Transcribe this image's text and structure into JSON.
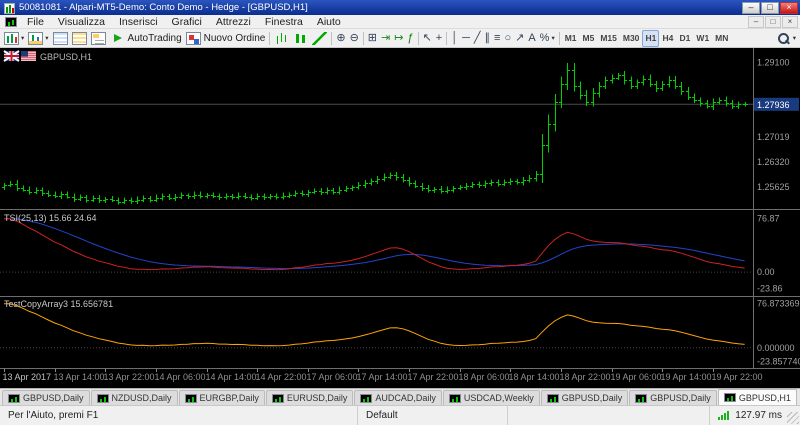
{
  "window": {
    "title": "50081081 - Alpari-MT5-Demo: Conto Demo - Hedge - [GBPUSD,H1]",
    "controls": [
      {
        "name": "minimize-button",
        "glyph": "–"
      },
      {
        "name": "maximize-button",
        "glyph": "□"
      },
      {
        "name": "close-button",
        "glyph": "×"
      }
    ]
  },
  "menu": {
    "items": [
      "File",
      "Visualizza",
      "Inserisci",
      "Grafici",
      "Attrezzi",
      "Finestra",
      "Aiuto"
    ],
    "child_controls": [
      {
        "name": "chart-minimize-button",
        "glyph": "–"
      },
      {
        "name": "chart-restore-button",
        "glyph": "□"
      },
      {
        "name": "chart-close-button",
        "glyph": "×"
      }
    ]
  },
  "toolbar": {
    "items": [
      {
        "name": "new-chart-button",
        "icon": "candles-icon",
        "caret": true
      },
      {
        "name": "profiles-button",
        "icon": "profiles-icon",
        "caret": true
      },
      {
        "name": "market-watch-button",
        "icon": "market-watch-icon"
      },
      {
        "name": "data-window-button",
        "icon": "data-window-icon"
      },
      {
        "name": "navigator-button",
        "icon": "navigator-icon"
      },
      {
        "name": "autotrading-button",
        "icon": "play-icon",
        "label": "AutoTrading"
      },
      {
        "name": "new-order-button",
        "icon": "new-order-icon",
        "label": "Nuovo Ordine"
      },
      {
        "sep": true
      },
      {
        "name": "bar-chart-button",
        "icon": "bar-chart-icon"
      },
      {
        "name": "candle-chart-button",
        "icon": "candle-chart-icon"
      },
      {
        "name": "line-chart-button",
        "icon": "line-chart-icon"
      },
      {
        "sep": true
      },
      {
        "name": "zoom-in-button",
        "glyph": "⊕"
      },
      {
        "name": "zoom-out-button",
        "glyph": "⊖"
      },
      {
        "sep": true
      },
      {
        "name": "tile-windows-button",
        "glyph": "⊞"
      },
      {
        "name": "auto-scroll-button",
        "glyph": "⇥",
        "color": "#1f8b1f"
      },
      {
        "name": "chart-shift-button",
        "glyph": "↦",
        "color": "#1f8b1f"
      },
      {
        "name": "indicators-button",
        "glyph": "ƒ",
        "color": "#0a7d0a"
      },
      {
        "sep": true
      },
      {
        "name": "cursor-button",
        "glyph": "↖"
      },
      {
        "name": "crosshair-button",
        "glyph": "+"
      },
      {
        "sep": true
      },
      {
        "name": "vertical-line-button",
        "glyph": "│"
      },
      {
        "name": "horizontal-line-button",
        "glyph": "─"
      },
      {
        "name": "trendline-button",
        "glyph": "╱"
      },
      {
        "name": "channel-button",
        "glyph": "∥"
      },
      {
        "name": "fibonacci-button",
        "glyph": "≡"
      },
      {
        "name": "shapes-button",
        "glyph": "○"
      },
      {
        "name": "arrows-button",
        "glyph": "↗"
      },
      {
        "name": "text-button",
        "glyph": "A"
      },
      {
        "name": "objects-button",
        "glyph": "%",
        "caret": true
      },
      {
        "sep": true
      }
    ],
    "timeframes": [
      "M1",
      "M5",
      "M15",
      "M30",
      "H1",
      "H4",
      "D1",
      "W1",
      "MN"
    ],
    "active_timeframe": "H1"
  },
  "chart": {
    "symbol_label": "GBPUSD,H1",
    "flags": [
      "gb-flag-icon",
      "us-flag-icon"
    ]
  },
  "tabs": {
    "items": [
      "GBPUSD,Daily",
      "NZDUSD,Daily",
      "EURGBP,Daily",
      "EURUSD,Daily",
      "AUDCAD,Daily",
      "USDCAD,Weekly",
      "GBPUSD,Daily",
      "GBPUSD,Daily",
      "GBPUSD,H1"
    ],
    "active_index": 8
  },
  "status_bar": {
    "help": "Per l'Aiuto, premi F1",
    "profile": "Default",
    "ping": "127.97 ms"
  },
  "chart_data": {
    "type": "ohlc-bars",
    "symbol": "GBPUSD",
    "timeframe": "H1",
    "bar_color": "#00D000",
    "background": "#000000",
    "main": {
      "open_first": 1.2563,
      "closes": [
        1.2568,
        1.2572,
        1.2561,
        1.2556,
        1.255,
        1.2554,
        1.2546,
        1.2542,
        1.2538,
        1.2543,
        1.2536,
        1.253,
        1.2534,
        1.2528,
        1.2532,
        1.2526,
        1.253,
        1.2526,
        1.2522,
        1.2527,
        1.2523,
        1.2528,
        1.2532,
        1.2528,
        1.2533,
        1.2537,
        1.2532,
        1.2536,
        1.254,
        1.2537,
        1.2542,
        1.2538,
        1.2541,
        1.2537,
        1.2534,
        1.2538,
        1.2535,
        1.2539,
        1.2536,
        1.2533,
        1.2537,
        1.2534,
        1.2538,
        1.2535,
        1.2539,
        1.2542,
        1.2546,
        1.2543,
        1.2548,
        1.2552,
        1.2549,
        1.2554,
        1.255,
        1.2556,
        1.2559,
        1.2562,
        1.2568,
        1.2574,
        1.258,
        1.2586,
        1.2592,
        1.2597,
        1.259,
        1.2582,
        1.2574,
        1.2566,
        1.256,
        1.2554,
        1.2558,
        1.2552,
        1.2556,
        1.256,
        1.2562,
        1.2566,
        1.2571,
        1.2568,
        1.2573,
        1.2577,
        1.2572,
        1.2576,
        1.258,
        1.2576,
        1.2582,
        1.2588,
        1.26,
        1.268,
        1.274,
        1.28,
        1.285,
        1.289,
        1.2845,
        1.282,
        1.28,
        1.2825,
        1.2845,
        1.286,
        1.2868,
        1.2875,
        1.286,
        1.2845,
        1.2855,
        1.2865,
        1.285,
        1.2838,
        1.285,
        1.2862,
        1.2846,
        1.283,
        1.2815,
        1.2805,
        1.2796,
        1.2788,
        1.28,
        1.2806,
        1.2796,
        1.2788,
        1.2794,
        1.27936
      ],
      "current_price": 1.27936,
      "current_price_text": "1.27936",
      "price_max_visible": 1.2945,
      "price_min_visible": 1.251
    },
    "price_axis": [
      {
        "text": "1.29100",
        "value": 1.291
      },
      {
        "text": "1.27019",
        "value": 1.27019
      },
      {
        "text": "1.26320",
        "value": 1.2632
      },
      {
        "text": "1.25625",
        "value": 1.25625
      }
    ],
    "price_box_color": "#1a3a80",
    "time_axis": [
      {
        "bar": 0,
        "label": "13 Apr 2017"
      },
      {
        "bar": 8,
        "label": "13 Apr 14:00"
      },
      {
        "bar": 16,
        "label": "13 Apr 22:00"
      },
      {
        "bar": 24,
        "label": "14 Apr 06:00"
      },
      {
        "bar": 32,
        "label": "14 Apr 14:00"
      },
      {
        "bar": 40,
        "label": "14 Apr 22:00"
      },
      {
        "bar": 48,
        "label": "17 Apr 06:00"
      },
      {
        "bar": 56,
        "label": "17 Apr 14:00"
      },
      {
        "bar": 64,
        "label": "17 Apr 22:00"
      },
      {
        "bar": 72,
        "label": "18 Apr 06:00"
      },
      {
        "bar": 80,
        "label": "18 Apr 14:00"
      },
      {
        "bar": 88,
        "label": "18 Apr 22:00"
      },
      {
        "bar": 96,
        "label": "19 Apr 06:00"
      },
      {
        "bar": 104,
        "label": "19 Apr 14:00"
      },
      {
        "bar": 112,
        "label": "19 Apr 22:00"
      }
    ],
    "indicators": [
      {
        "name": "TSI",
        "label": "TSI(25,13) 15.66 24.64",
        "params": [
          25,
          13
        ],
        "last_values": [
          15.66,
          24.64
        ],
        "colors": [
          "#CC2222",
          "#2244CC"
        ],
        "axis": [
          {
            "text": "76.87",
            "value": 76.87
          },
          {
            "text": "0.00",
            "value": 0
          },
          {
            "text": "-23.86",
            "value": -23.86
          }
        ]
      },
      {
        "name": "TestCopyArray3",
        "label": "TestCopyArray3 15.656781",
        "last_values": [
          15.656781
        ],
        "colors": [
          "#FFA500"
        ],
        "axis": [
          {
            "text": "76.873369",
            "value": 76.873369
          },
          {
            "text": "0.000000",
            "value": 0
          },
          {
            "text": "-23.857740",
            "value": -23.85774
          }
        ]
      }
    ]
  }
}
